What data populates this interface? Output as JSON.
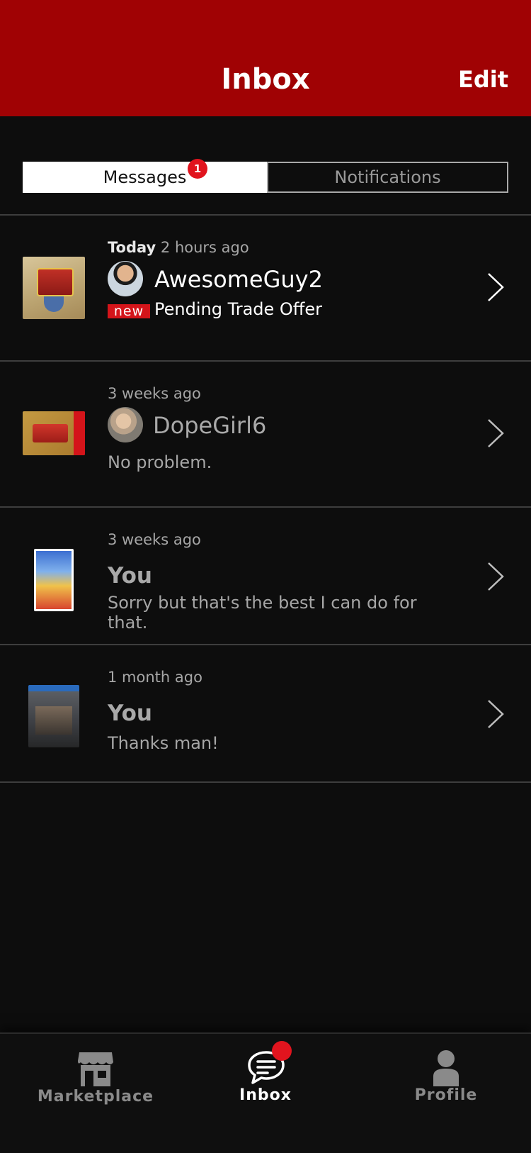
{
  "header": {
    "title": "Inbox",
    "edit_label": "Edit",
    "background_color": "#a00204"
  },
  "tabs": {
    "messages_label": "Messages",
    "messages_badge": "1",
    "notifications_label": "Notifications",
    "active": "Messages"
  },
  "messages": [
    {
      "day": "Today",
      "time": "2 hours ago",
      "name": "AwesomeGuy2",
      "new_label": "new",
      "preview": "Pending Trade Offer",
      "thumbnail": "zelda-game-cover",
      "avatar": "user-avatar-photo"
    },
    {
      "time": "3 weeks ago",
      "name": "DopeGirl6",
      "preview": "No problem.",
      "thumbnail": "zelda-n64-game-cover",
      "avatar": "user-avatar-photo"
    },
    {
      "time": "3 weeks ago",
      "name": "You",
      "preview": "Sorry but that's the best I can do for that.",
      "thumbnail": "smash-bros-game-cover"
    },
    {
      "time": "1 month ago",
      "name": "You",
      "preview": "Thanks man!",
      "thumbnail": "division-2-game-cover"
    }
  ],
  "tabbar": {
    "marketplace_label": "Marketplace",
    "inbox_label": "Inbox",
    "profile_label": "Profile",
    "active": "Inbox",
    "badge_color": "#e1141e"
  }
}
